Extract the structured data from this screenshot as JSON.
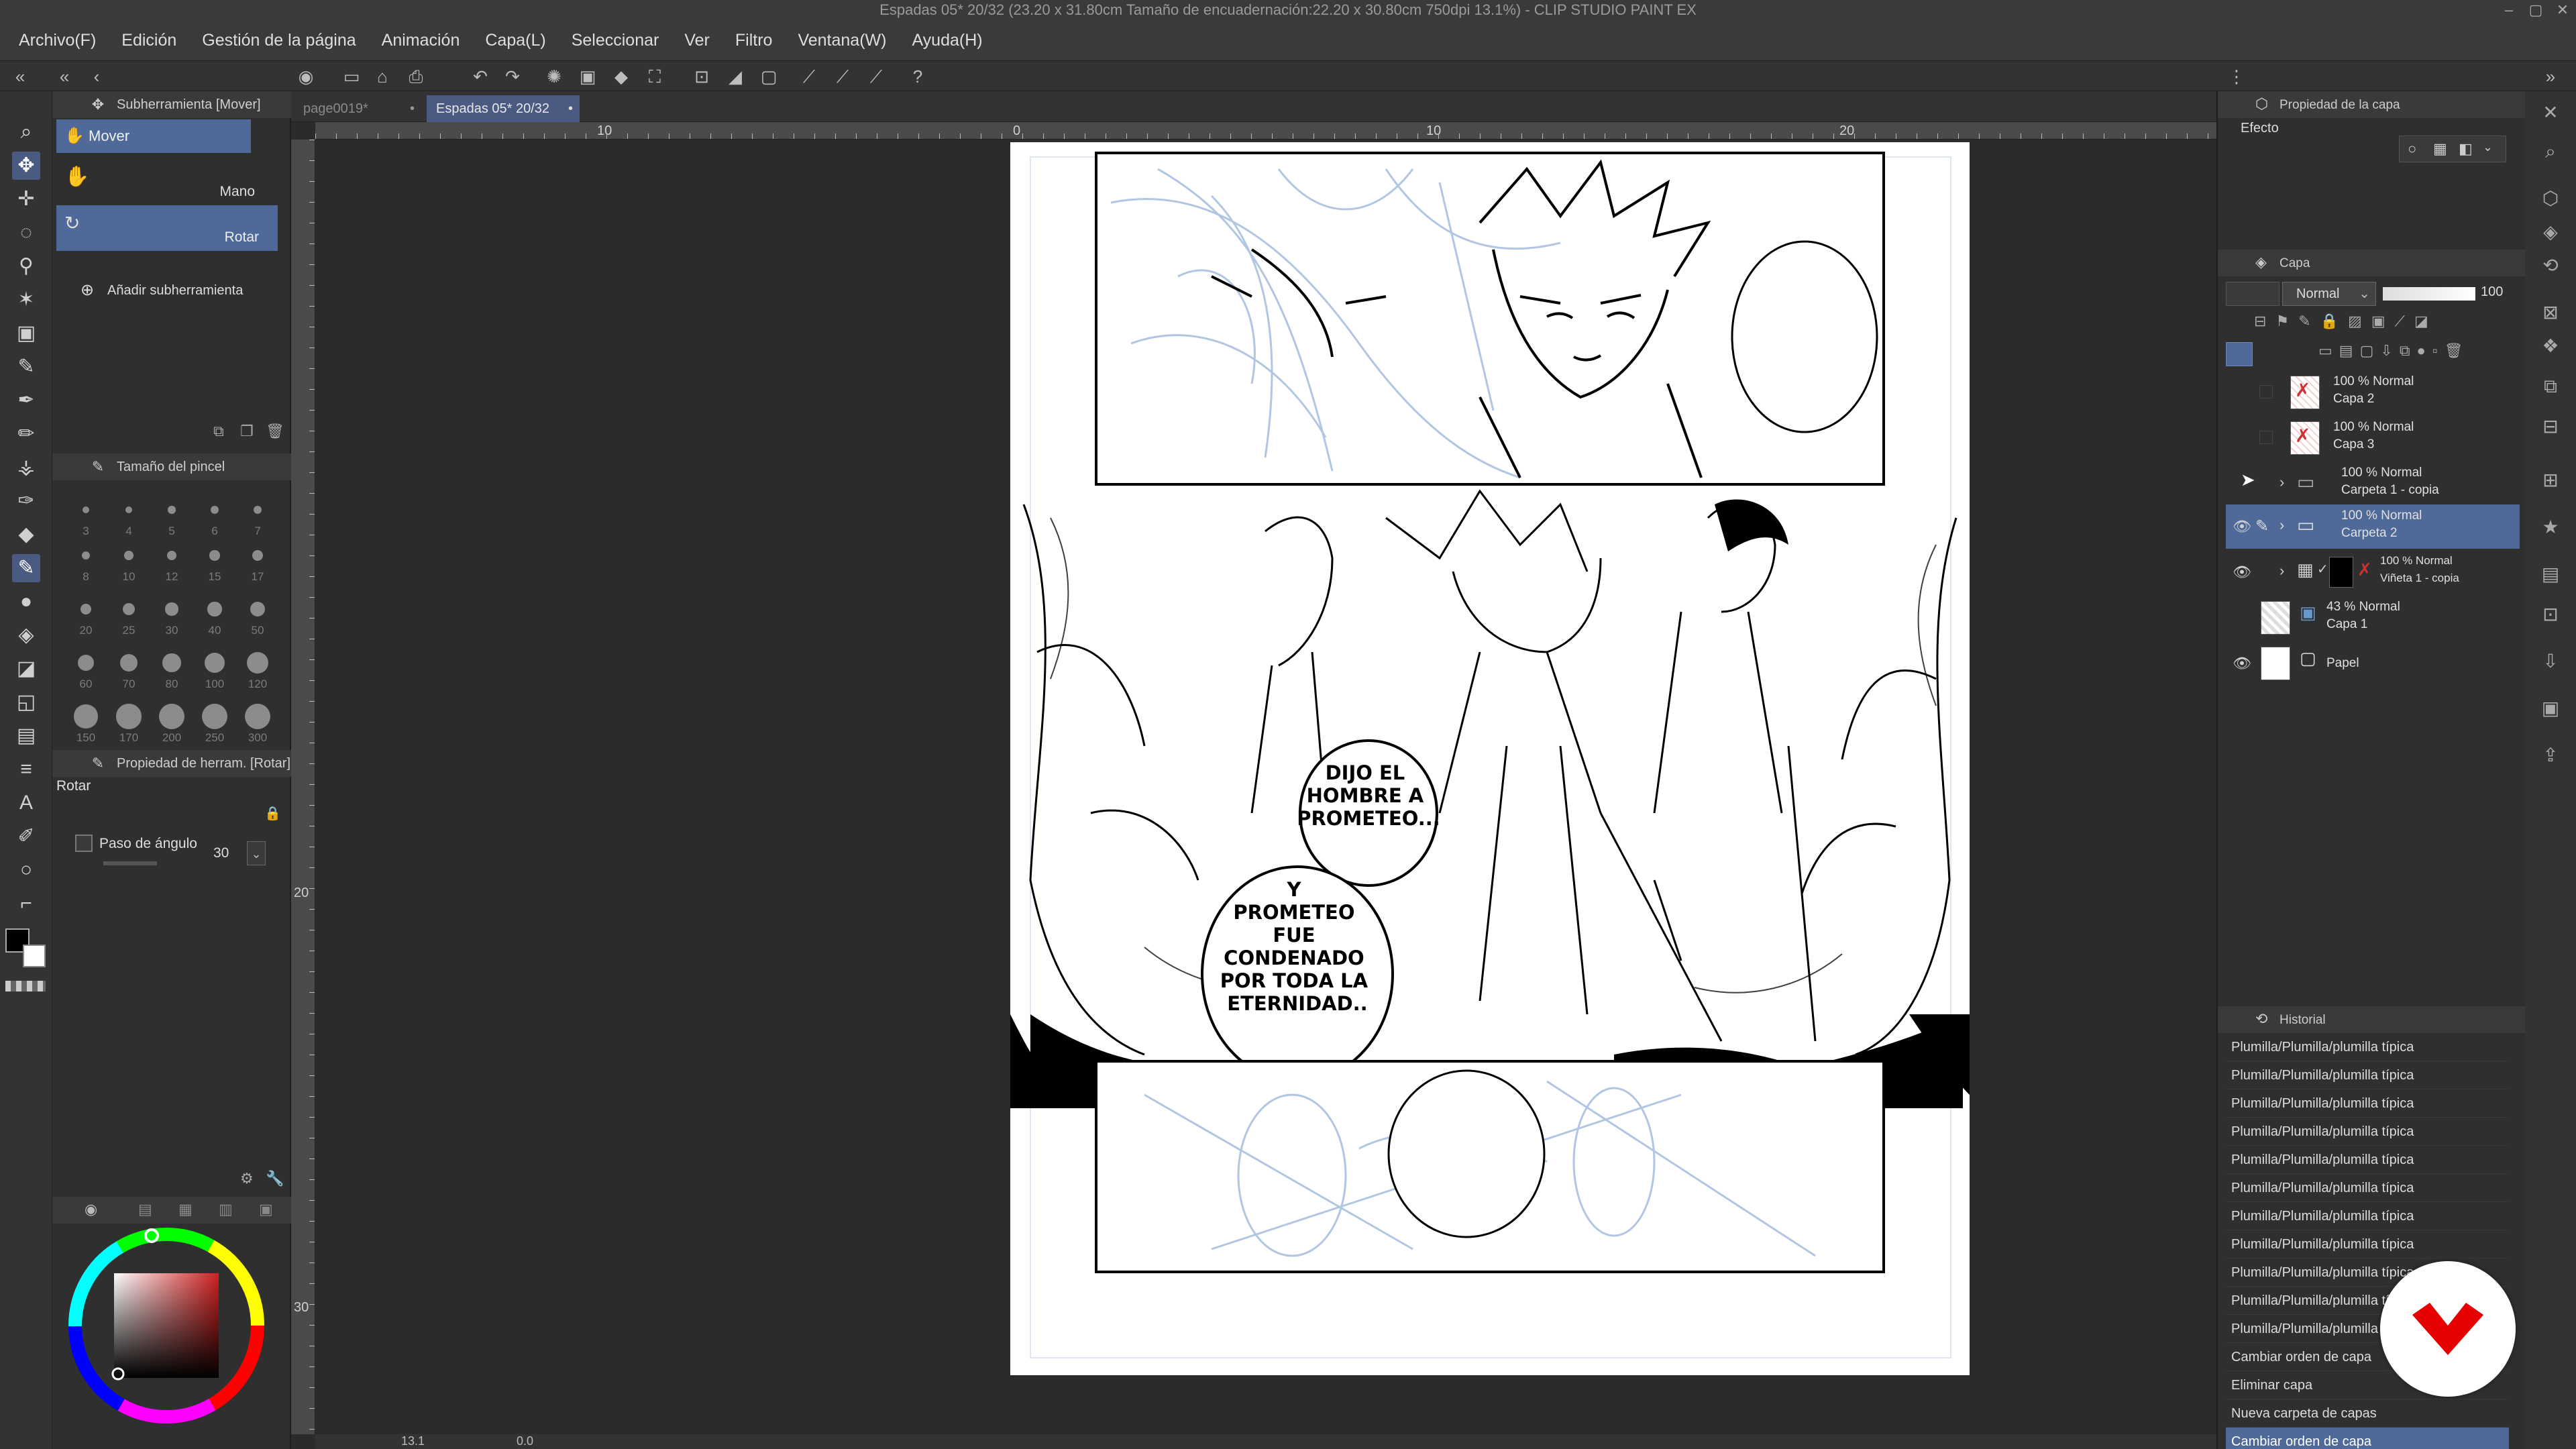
{
  "window": {
    "title": "Espadas 05* 20/32 (23.20 x 31.80cm Tamaño de encuadernación:22.20 x 30.80cm 750dpi 13.1%) - CLIP STUDIO PAINT EX"
  },
  "menu": [
    "Archivo(F)",
    "Edición",
    "Gestión de la página",
    "Animación",
    "Capa(L)",
    "Seleccionar",
    "Ver",
    "Filtro",
    "Ventana(W)",
    "Ayuda(H)"
  ],
  "tabs": [
    {
      "label": "page0019*",
      "active": false
    },
    {
      "label": "Espadas 05* 20/32",
      "active": true
    }
  ],
  "subtool_panel": {
    "title": "Subherramienta [Mover]",
    "group": "Mover",
    "items": [
      "Mano",
      "Rotar"
    ],
    "add_label": "Añadir subherramienta"
  },
  "brush_size_panel": {
    "title": "Tamaño del pincel",
    "sizes": [
      "3",
      "4",
      "5",
      "6",
      "7",
      "8",
      "10",
      "12",
      "15",
      "17",
      "20",
      "25",
      "30",
      "40",
      "50",
      "60",
      "70",
      "80",
      "100",
      "120",
      "150",
      "170",
      "200",
      "250",
      "300"
    ]
  },
  "tool_property_panel": {
    "title": "Propiedad de herram. [Rotar]",
    "tool_name": "Rotar",
    "angle_step_label": "Paso de ángulo",
    "angle_step_value": "30"
  },
  "ruler": {
    "top": [
      "10",
      "0",
      "10",
      "20"
    ],
    "left": [
      "20",
      "30"
    ]
  },
  "balloons": {
    "top": [
      "DIJO EL",
      "HOMBRE A",
      "PROMETEO..."
    ],
    "bottom": [
      "Y",
      "PROMETEO",
      "FUE",
      "CONDENADO",
      "POR TODA LA",
      "ETERNIDAD.."
    ]
  },
  "layer_property": {
    "title": "Propiedad de la capa",
    "effect_label": "Efecto"
  },
  "layer_panel": {
    "title": "Capa",
    "blend_mode": "Normal",
    "opacity": "100",
    "layers": [
      {
        "line1": "100 % Normal",
        "line2": "Capa 2",
        "visible": false,
        "selected": false,
        "folder": false
      },
      {
        "line1": "100 % Normal",
        "line2": "Capa 3",
        "visible": false,
        "selected": false,
        "folder": false
      },
      {
        "line1": "100 % Normal",
        "line2": "Carpeta 1 - copia",
        "visible": false,
        "selected": false,
        "folder": true
      },
      {
        "line1": "100 % Normal",
        "line2": "Carpeta 2",
        "visible": true,
        "selected": true,
        "folder": true
      },
      {
        "line1": "100 % Normal",
        "line2": "Viñeta 1 - copia",
        "visible": true,
        "selected": false,
        "folder": true
      },
      {
        "line1": "43 % Normal",
        "line2": "Capa 1",
        "visible": false,
        "selected": false,
        "folder": false
      },
      {
        "line1": "",
        "line2": "Papel",
        "visible": true,
        "selected": false,
        "folder": false
      }
    ]
  },
  "history_panel": {
    "title": "Historial",
    "items": [
      "Plumilla/Plumilla/plumilla típica",
      "Plumilla/Plumilla/plumilla típica",
      "Plumilla/Plumilla/plumilla típica",
      "Plumilla/Plumilla/plumilla típica",
      "Plumilla/Plumilla/plumilla típica",
      "Plumilla/Plumilla/plumilla típica",
      "Plumilla/Plumilla/plumilla típica",
      "Plumilla/Plumilla/plumilla típica",
      "Plumilla/Plumilla/plumilla típica",
      "Plumilla/Plumilla/plumilla típica",
      "Plumilla/Plumilla/plumilla típica",
      "Cambiar orden de capa",
      "Eliminar capa",
      "Nueva carpeta de capas",
      "Cambiar orden de capa"
    ]
  },
  "status": {
    "zoom": "13.1",
    "angle": "0.0"
  },
  "colors": {
    "accent": "#4f6a99",
    "panel_bg": "#2f2f2f",
    "canvas_bg": "#2b2b2b"
  }
}
